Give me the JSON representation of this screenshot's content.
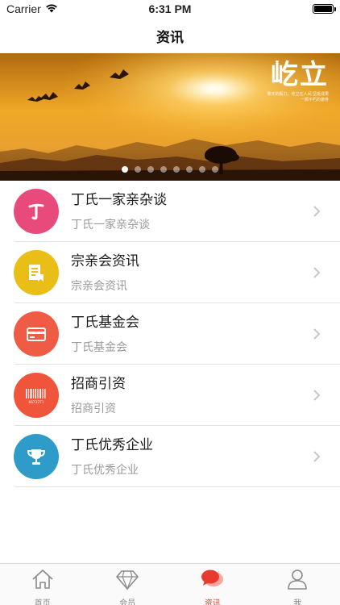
{
  "status_bar": {
    "carrier": "Carrier",
    "time": "6:31 PM"
  },
  "nav": {
    "title": "资讯"
  },
  "banner": {
    "logo_text": "屹立",
    "tagline_1": "擎天的毅力，屹立在人间 坚挺成果",
    "tagline_2": "一颗不朽的傲骨",
    "dot_count": 8,
    "active_dot": 0
  },
  "list": [
    {
      "title": "丁氏一家亲杂谈",
      "subtitle": "丁氏一家亲杂谈",
      "icon": "ding-character-icon",
      "color": "#e94a7c"
    },
    {
      "title": "宗亲会资讯",
      "subtitle": "宗亲会资讯",
      "icon": "document-icon",
      "color": "#e9be17"
    },
    {
      "title": "丁氏基金会",
      "subtitle": "丁氏基金会",
      "icon": "card-icon",
      "color": "#ef5b45"
    },
    {
      "title": "招商引资",
      "subtitle": "招商引资",
      "icon": "barcode-icon",
      "color": "#f0553c"
    },
    {
      "title": "丁氏优秀企业",
      "subtitle": "丁氏优秀企业",
      "icon": "trophy-icon",
      "color": "#2e9bc8"
    }
  ],
  "barcode_text": "6673271",
  "tabs": [
    {
      "label": "首页",
      "icon": "home-icon",
      "active": false
    },
    {
      "label": "会员",
      "icon": "diamond-icon",
      "active": false
    },
    {
      "label": "资讯",
      "icon": "chat-bubbles-icon",
      "active": true
    },
    {
      "label": "我",
      "icon": "person-icon",
      "active": false
    }
  ],
  "colors": {
    "accent": "#e83a2e",
    "inactive": "#8a8a8a"
  }
}
